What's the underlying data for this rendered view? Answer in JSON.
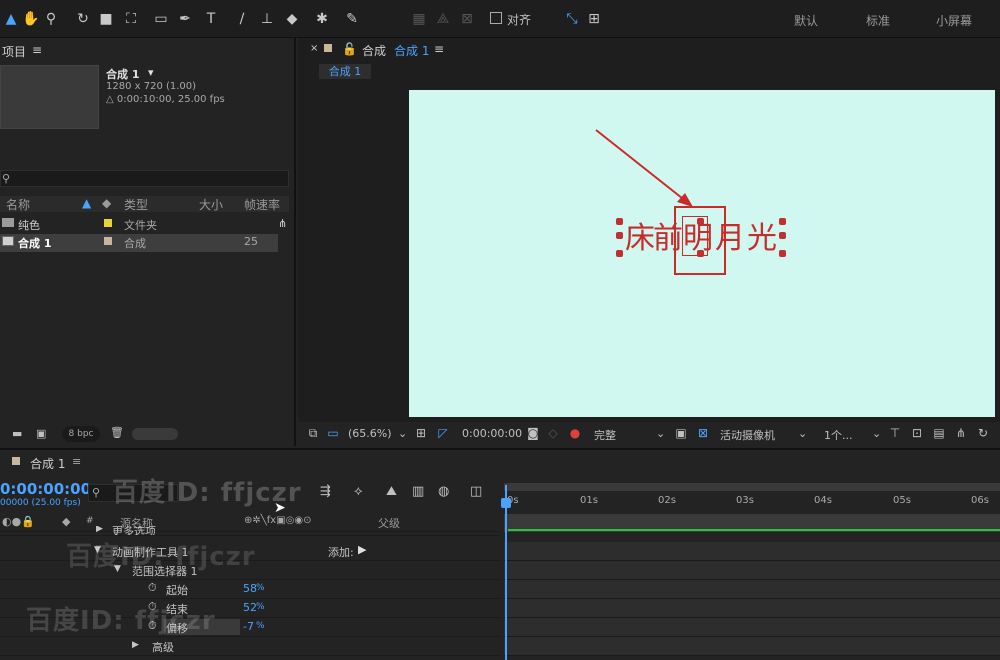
{
  "toolbar": {
    "snap_label": "对齐",
    "workspaces": [
      "默认",
      "标准",
      "小屏幕"
    ]
  },
  "project_panel": {
    "title": "项目",
    "comp_name": "合成 1",
    "comp_resolution": "1280 x 720 (1.00)",
    "comp_duration": "△ 0:00:10:00, 25.00 fps",
    "search_placeholder": "",
    "columns": {
      "name": "名称",
      "type": "类型",
      "size": "大小",
      "fps": "帧速率"
    },
    "items": [
      {
        "name": "纯色",
        "type": "文件夹",
        "fps": ""
      },
      {
        "name": "合成 1",
        "type": "合成",
        "fps": "25"
      }
    ],
    "footer_bpc": "8 bpc"
  },
  "comp_viewer": {
    "tab_prefix": "合成",
    "tab_name": "合成 1",
    "breadcrumb": "合成 1",
    "text_chars": [
      "床",
      "前",
      "明",
      "月",
      "光"
    ],
    "zoom": "(65.6%)",
    "timecode": "0:00:00:00",
    "resolution": "完整",
    "camera": "活动摄像机",
    "views": "1个..."
  },
  "timeline": {
    "comp_tab": "合成 1",
    "timecode": "0:00:00:00",
    "frame_info": "00000 (25.00 fps)",
    "source_name_col": "源名称",
    "parent_col": "父级",
    "layers": [
      {
        "label": "更多选项",
        "indent": 1
      },
      {
        "label": "动画制作工具 1",
        "indent": 1,
        "add_label": "添加:"
      },
      {
        "label": "范围选择器 1",
        "indent": 2
      },
      {
        "label": "起始",
        "indent": 3,
        "value": "58",
        "unit": "%"
      },
      {
        "label": "结束",
        "indent": 3,
        "value": "52",
        "unit": "%"
      },
      {
        "label": "偏移",
        "indent": 3,
        "value": "-7",
        "unit": "%"
      },
      {
        "label": "高级",
        "indent": 2
      }
    ],
    "ruler": [
      "0s",
      "01s",
      "02s",
      "03s",
      "04s",
      "05s",
      "06s"
    ]
  },
  "watermark": {
    "text1": "百度ID: ffjczr",
    "text2": "百度ID: ffjczr"
  }
}
